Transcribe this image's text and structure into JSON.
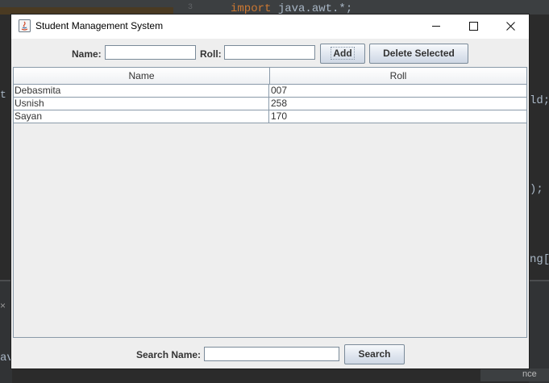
{
  "ide": {
    "code_keyword": "import",
    "code_rest": " java.awt.*;",
    "gutter_mark": "3",
    "left_fragment": "t S",
    "right_fragments": [
      "ld;",
      ");",
      "ng[]"
    ],
    "bottom_left_fragment": "av",
    "bottom_right_label": "nce",
    "panel_close": "×"
  },
  "window": {
    "title": "Student Management System"
  },
  "toolbar": {
    "name_label": "Name:",
    "name_value": "",
    "roll_label": "Roll:",
    "roll_value": "",
    "add_label": "Add",
    "delete_label": "Delete Selected"
  },
  "table": {
    "columns": [
      "Name",
      "Roll"
    ],
    "rows": [
      [
        "Debasmita",
        "007"
      ],
      [
        "Usnish",
        "258"
      ],
      [
        "Sayan",
        "170"
      ]
    ]
  },
  "search": {
    "label": "Search Name:",
    "value": "",
    "button_label": "Search"
  }
}
